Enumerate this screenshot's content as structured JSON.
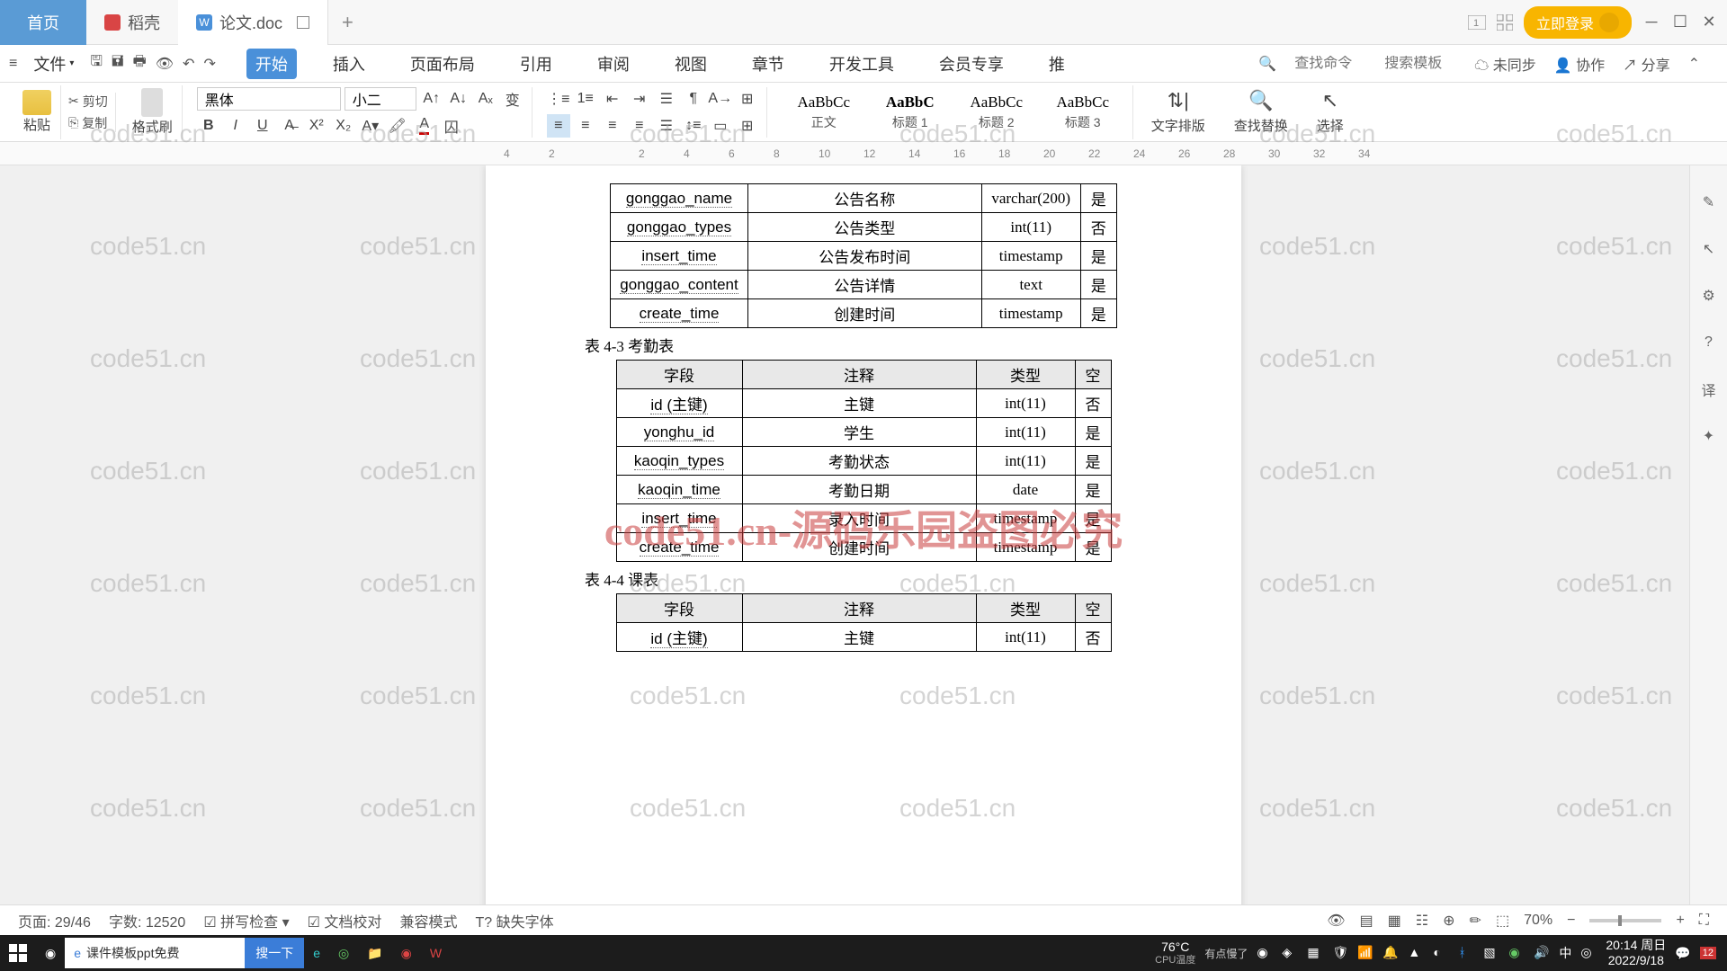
{
  "tabs": {
    "home": "首页",
    "daoke": "稻壳",
    "doc": "论文.doc"
  },
  "login": "立即登录",
  "file_menu": "文件",
  "menu": [
    "开始",
    "插入",
    "页面布局",
    "引用",
    "审阅",
    "视图",
    "章节",
    "开发工具",
    "会员专享",
    "推"
  ],
  "menubar_right": {
    "search_cmd": "查找命令",
    "search_tpl": "搜索模板",
    "unsync": "未同步",
    "collab": "协作",
    "share": "分享"
  },
  "ribbon": {
    "paste": "粘贴",
    "cut": "剪切",
    "copy": "复制",
    "format_painter": "格式刷",
    "font_name": "黑体",
    "font_size": "小二",
    "styles": [
      {
        "preview": "AaBbCc",
        "name": "正文"
      },
      {
        "preview": "AaBbC",
        "name": "标题 1"
      },
      {
        "preview": "AaBbCc",
        "name": "标题 2"
      },
      {
        "preview": "AaBbCc",
        "name": "标题 3"
      }
    ],
    "text_layout": "文字排版",
    "find_replace": "查找替换",
    "select": "选择"
  },
  "ruler": [
    "4",
    "2",
    "",
    "2",
    "4",
    "6",
    "8",
    "10",
    "12",
    "14",
    "16",
    "18",
    "20",
    "22",
    "24",
    "26",
    "28",
    "30",
    "32",
    "34"
  ],
  "doc": {
    "table1_rows": [
      [
        "gonggao_name",
        "公告名称",
        "varchar(200)",
        "是"
      ],
      [
        "gonggao_types",
        "公告类型",
        "int(11)",
        "否"
      ],
      [
        "insert_time",
        "公告发布时间",
        "timestamp",
        "是"
      ],
      [
        "gonggao_content",
        "公告详情",
        "text",
        "是"
      ],
      [
        "create_time",
        "创建时间",
        "timestamp",
        "是"
      ]
    ],
    "caption2": "表 4-3  考勤表",
    "table2_header": [
      "字段",
      "注释",
      "类型",
      "空"
    ],
    "table2_rows": [
      [
        "id (主键)",
        "主键",
        "int(11)",
        "否"
      ],
      [
        "yonghu_id",
        "学生",
        "int(11)",
        "是"
      ],
      [
        "kaoqin_types",
        "考勤状态",
        "int(11)",
        "是"
      ],
      [
        "kaoqin_time",
        "考勤日期",
        "date",
        "是"
      ],
      [
        "insert_time",
        "录入时间",
        "timestamp",
        "是"
      ],
      [
        "create_time",
        "创建时间",
        "timestamp",
        "是"
      ]
    ],
    "caption3": "表 4-4  课表",
    "table3_header": [
      "字段",
      "注释",
      "类型",
      "空"
    ],
    "table3_rows": [
      [
        "id (主键)",
        "主键",
        "int(11)",
        "否"
      ]
    ]
  },
  "watermark": "code51.cn-源码乐园盗图必究",
  "bgwm": "code51.cn",
  "status": {
    "page": "页面: 29/46",
    "words": "字数: 12520",
    "spell": "拼写检查",
    "proof": "文档校对",
    "compat": "兼容模式",
    "missing": "缺失字体",
    "zoom": "70%"
  },
  "taskbar": {
    "search_ph": "课件模板ppt免费",
    "search_btn": "搜一下",
    "temp": "76°C",
    "cpu": "CPU温度",
    "slow": "有点慢了",
    "time": "20:14 周日",
    "date": "2022/9/18",
    "ime": "中"
  }
}
